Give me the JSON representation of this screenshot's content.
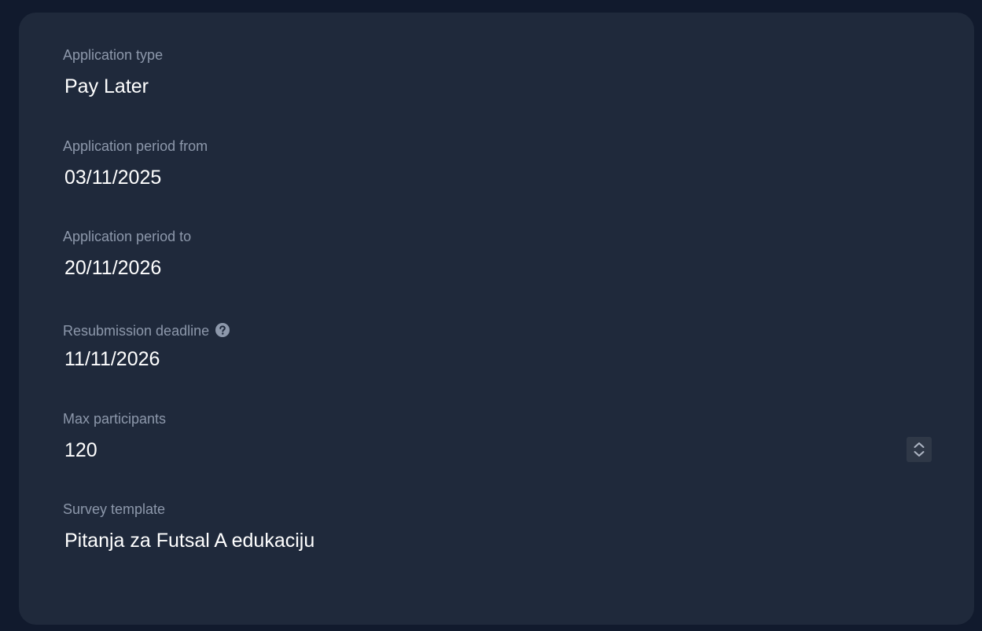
{
  "fields": {
    "application_type": {
      "label": "Application type",
      "value": "Pay Later"
    },
    "period_from": {
      "label": "Application period from",
      "value": "03/11/2025"
    },
    "period_to": {
      "label": "Application period to",
      "value": "20/11/2026"
    },
    "resubmission_deadline": {
      "label": "Resubmission deadline",
      "value": "11/11/2026",
      "icon": "help-circle-icon"
    },
    "max_participants": {
      "label": "Max participants",
      "value": "120",
      "control_icon": "number-stepper-icon"
    },
    "survey_template": {
      "label": "Survey template",
      "value": "Pitanja za Futsal A edukaciju"
    }
  },
  "colors": {
    "page_bg": "#111a2d",
    "card_bg": "#1f293b",
    "label_text": "#8d98ab",
    "value_text": "#ffffff"
  }
}
